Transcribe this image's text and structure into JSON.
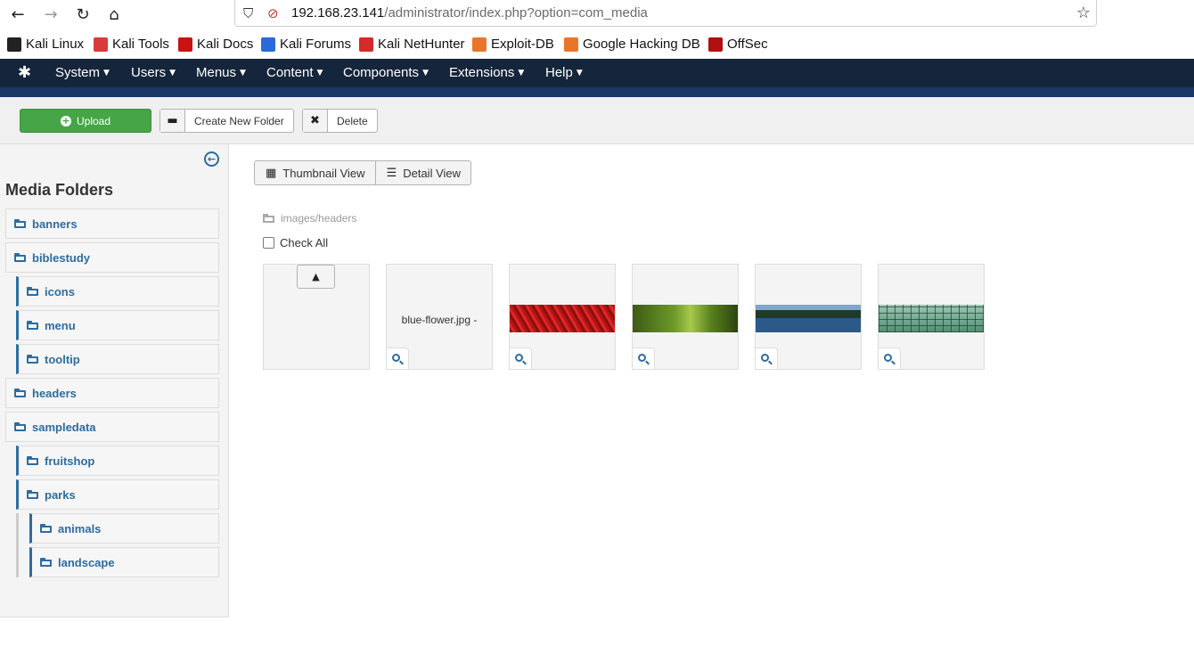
{
  "browser": {
    "url_host": "192.168.23.141",
    "url_path": "/administrator/index.php?option=com_media"
  },
  "bookmarks": [
    {
      "label": "Kali Linux",
      "icon": "kali-dragon-icon",
      "color": "#222222"
    },
    {
      "label": "Kali Tools",
      "icon": "kali-tools-icon",
      "color": "#d93a3a"
    },
    {
      "label": "Kali Docs",
      "icon": "kali-docs-icon",
      "color": "#cc1111"
    },
    {
      "label": "Kali Forums",
      "icon": "kali-forums-icon",
      "color": "#2a6ad8"
    },
    {
      "label": "Kali NetHunter",
      "icon": "kali-nethunter-icon",
      "color": "#d42a2a"
    },
    {
      "label": "Exploit-DB",
      "icon": "exploit-db-icon",
      "color": "#e8762a"
    },
    {
      "label": "Google Hacking DB",
      "icon": "ghdb-icon",
      "color": "#e8762a"
    },
    {
      "label": "OffSec",
      "icon": "offsec-icon",
      "color": "#b01010"
    }
  ],
  "menu": [
    "System",
    "Users",
    "Menus",
    "Content",
    "Components",
    "Extensions",
    "Help"
  ],
  "toolbar": {
    "upload": "Upload",
    "create_folder": "Create New Folder",
    "delete": "Delete"
  },
  "sidebar": {
    "title": "Media Folders",
    "folders": [
      {
        "label": "banners",
        "level": 0
      },
      {
        "label": "biblestudy",
        "level": 0
      },
      {
        "label": "icons",
        "level": 1
      },
      {
        "label": "menu",
        "level": 1
      },
      {
        "label": "tooltip",
        "level": 1
      },
      {
        "label": "headers",
        "level": 0
      },
      {
        "label": "sampledata",
        "level": 0
      },
      {
        "label": "fruitshop",
        "level": 1
      },
      {
        "label": "parks",
        "level": 1
      },
      {
        "label": "animals",
        "level": 2
      },
      {
        "label": "landscape",
        "level": 2
      }
    ]
  },
  "main": {
    "thumbnail_view": "Thumbnail View",
    "detail_view": "Detail View",
    "path": "images/headers",
    "check_all": "Check All",
    "items": [
      {
        "type": "up"
      },
      {
        "type": "caption",
        "caption": "blue-flower.jpg -"
      },
      {
        "type": "image",
        "image": "red-flowers"
      },
      {
        "type": "image",
        "image": "green-leaves"
      },
      {
        "type": "image",
        "image": "lake-forest"
      },
      {
        "type": "image",
        "image": "glass-grid"
      }
    ]
  },
  "colors": {
    "nav_bg": "#15253b",
    "accent_blue": "#2d6ca2",
    "upload_green": "#46a546"
  }
}
